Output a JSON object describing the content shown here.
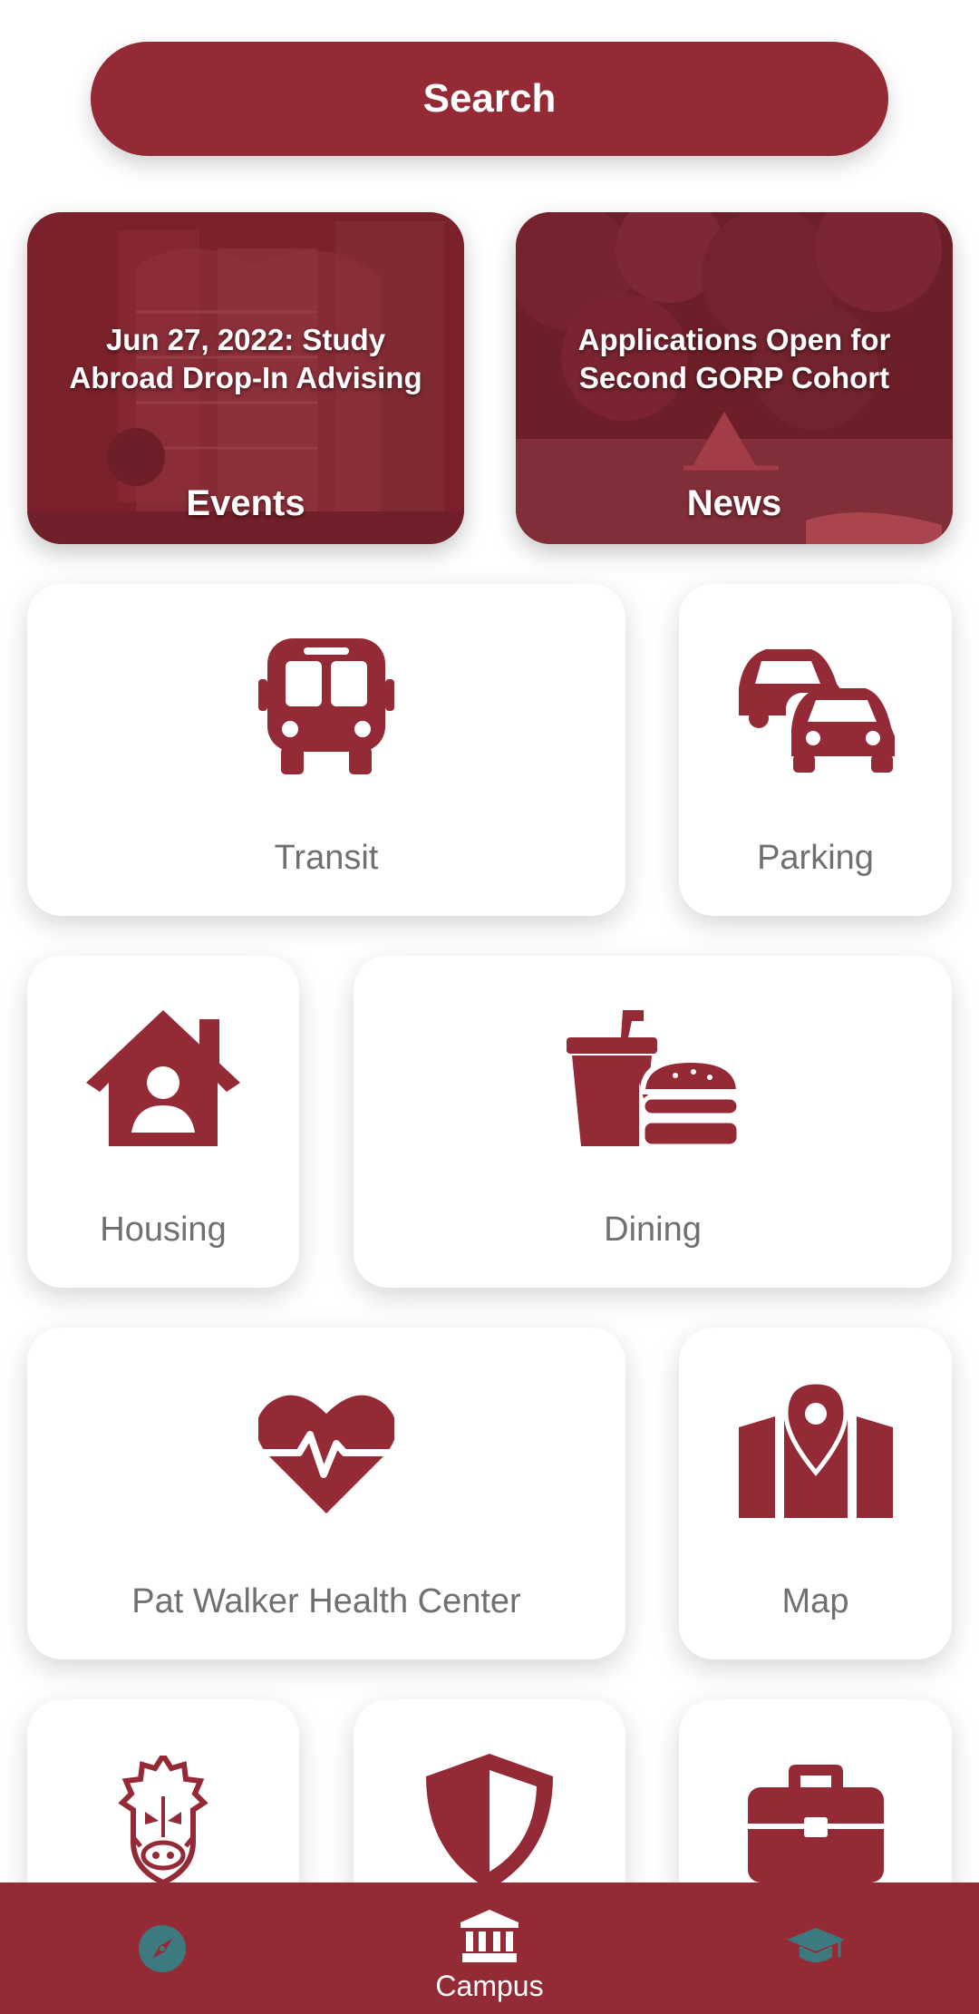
{
  "search": {
    "label": "Search"
  },
  "features": {
    "events": {
      "headline_line1": "Jun 27, 2022: Study",
      "headline_line2": "Abroad Drop-In Advising",
      "label": "Events"
    },
    "news": {
      "headline_line1": "Applications Open for",
      "headline_line2": "Second GORP Cohort",
      "label": "News"
    }
  },
  "tiles": {
    "transit": {
      "label": "Transit",
      "icon": "bus-icon"
    },
    "parking": {
      "label": "Parking",
      "icon": "cars-icon"
    },
    "housing": {
      "label": "Housing",
      "icon": "house-user-icon"
    },
    "dining": {
      "label": "Dining",
      "icon": "drink-burger-icon"
    },
    "health": {
      "label": "Pat Walker Health Center",
      "icon": "heartbeat-icon"
    },
    "map": {
      "label": "Map",
      "icon": "map-pin-icon"
    },
    "athletics": {
      "label": "",
      "icon": "razorback-icon"
    },
    "safety": {
      "label": "",
      "icon": "shield-icon"
    },
    "careers": {
      "label": "",
      "icon": "briefcase-icon"
    }
  },
  "nav": {
    "explore": {
      "icon": "compass-icon"
    },
    "campus": {
      "label": "Campus",
      "icon": "university-icon"
    },
    "academics": {
      "icon": "graduation-cap-icon"
    }
  },
  "colors": {
    "brand": "#952a37",
    "tile_text": "#707070",
    "nav_inactive": "#3c7a80"
  }
}
